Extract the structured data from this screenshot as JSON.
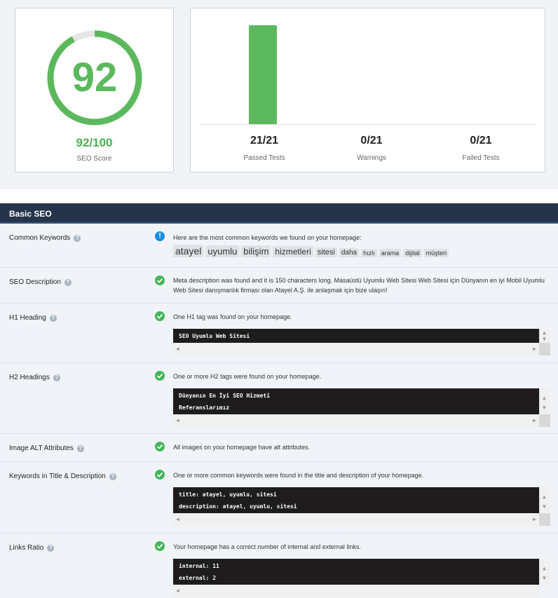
{
  "score": {
    "gauge_value": "92",
    "value": "92/100",
    "label": "SEO Score",
    "percent": 92,
    "accent_color": "#5cb85c"
  },
  "tests": {
    "passed_fraction": 1.0,
    "stats": [
      {
        "value": "21/21",
        "label": "Passed Tests"
      },
      {
        "value": "0/21",
        "label": "Warnings"
      },
      {
        "value": "0/21",
        "label": "Failed Tests"
      }
    ]
  },
  "section": {
    "title": "Basic SEO"
  },
  "rows": {
    "keywords": {
      "label": "Common Keywords",
      "text": "Here are the most common keywords we found on your homepage:",
      "items": [
        "atayel",
        "uyumlu",
        "bilişim",
        "hizmetleri",
        "sitesi",
        "daha",
        "hızlı",
        "arama",
        "dijital",
        "müşteri"
      ]
    },
    "description": {
      "label": "SEO Description",
      "text": "Meta description was found and it is 150 characters long. Masaüstü Uyumlu Web Sitesi Web Sitesi için Dünyanın en iyi Mobil Uyumlu Web Sitesi danışmanlık firması olan Atayel A.Ş. ile anlaşmak için bize ulaşın!"
    },
    "h1": {
      "label": "H1 Heading",
      "text": "One H1 tag was found on your homepage.",
      "code": [
        "SEO Uyumlu Web Sitesi"
      ]
    },
    "h2": {
      "label": "H2 Headings",
      "text": "One or more H2 tags were found on your homepage.",
      "code": [
        "Dünyanın En İyi SEO Hizmeti",
        "Referanslarımız"
      ]
    },
    "alt": {
      "label": "Image ALT Attributes",
      "text": "All images on your homepage have alt attributes."
    },
    "title_desc": {
      "label": "Keywords in Title & Description",
      "text": "One or more common keywords were found in the title and description of your homepage.",
      "code": [
        "title: atayel, uyumlu, sitesi",
        "description: atayel, uyumlu, sitesi"
      ]
    },
    "links": {
      "label": "Links Ratio",
      "text": "Your homepage has a correct number of internal and external links.",
      "code": [
        "internal: 11",
        "external: 2"
      ]
    }
  },
  "icons": {
    "ok": "check-circle-icon",
    "info": "info-circle-icon",
    "help": "question-circle-icon",
    "help_glyph": "?",
    "info_glyph": "!"
  }
}
